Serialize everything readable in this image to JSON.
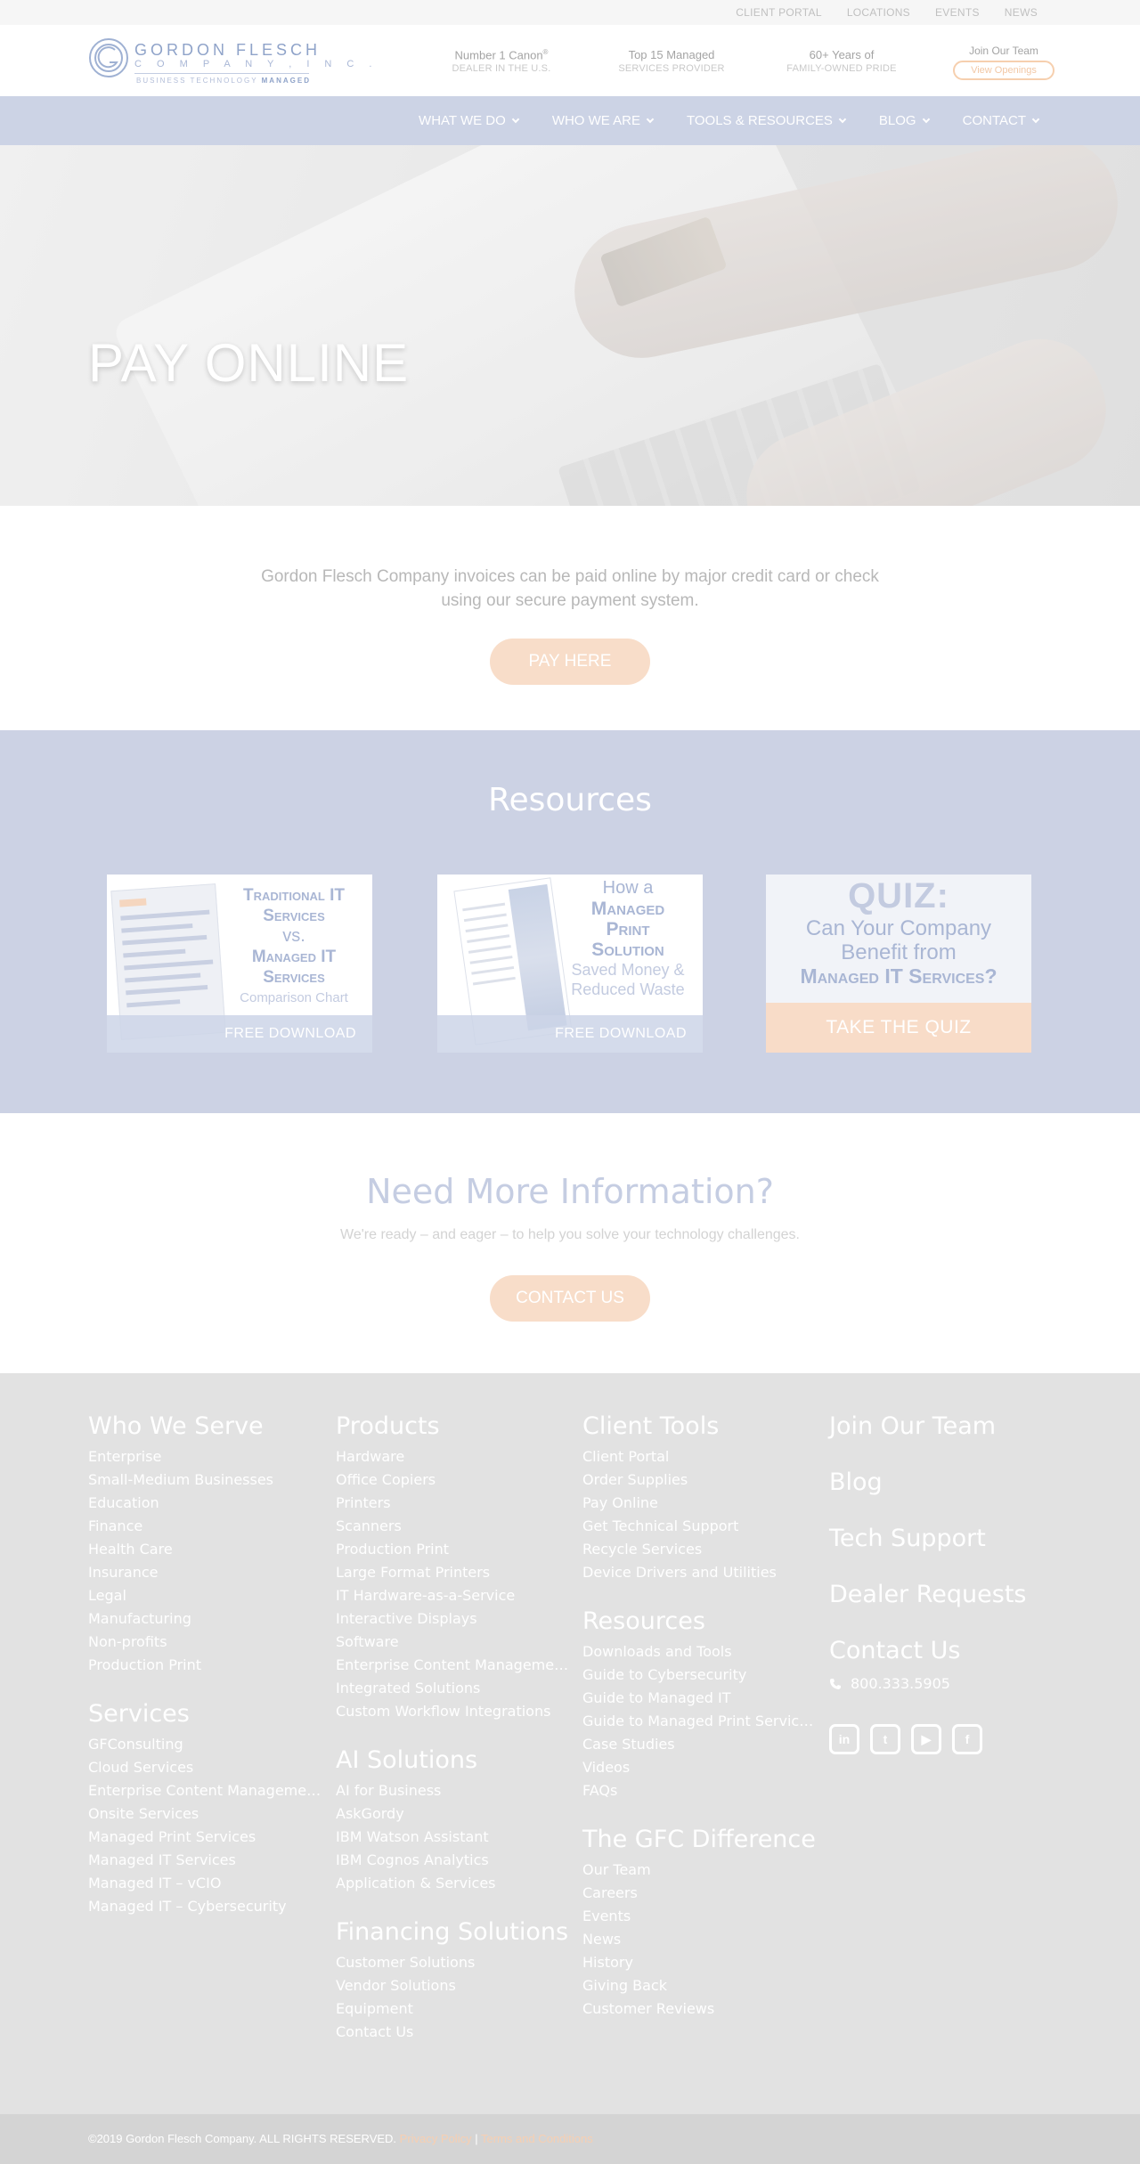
{
  "topbar": {
    "links": [
      "CLIENT PORTAL",
      "LOCATIONS",
      "EVENTS",
      "NEWS"
    ]
  },
  "logo": {
    "name": "GORDON FLESCH",
    "sub": "C O M P A N Y , I N C .",
    "tag_prefix": "BUSINESS TECHNOLOGY",
    "tag_bold": "MANAGED"
  },
  "stats": [
    {
      "line1": "Number 1 Canon",
      "sup": "®",
      "line2": "DEALER IN THE U.S."
    },
    {
      "line1": "Top 15 Managed",
      "line2": "SERVICES PROVIDER"
    },
    {
      "line1": "60+ Years of",
      "line2": "FAMILY-OWNED PRIDE"
    }
  ],
  "join": {
    "label": "Join Our Team",
    "button": "View Openings"
  },
  "nav": [
    "WHAT WE DO",
    "WHO WE ARE",
    "TOOLS & RESOURCES",
    "BLOG",
    "CONTACT"
  ],
  "hero": {
    "title": "PAY ONLINE"
  },
  "intro": {
    "text": "Gordon Flesch Company invoices can be paid online by major credit card or check using our secure payment system.",
    "button": "PAY HERE"
  },
  "resources": {
    "heading": "Resources",
    "card1": {
      "t1": "Traditional IT",
      "t2": "Services",
      "vs": "vs.",
      "t3": "Managed IT",
      "t4": "Services",
      "sub": "Comparison Chart",
      "cta": "FREE DOWNLOAD"
    },
    "card2": {
      "t1": "How a",
      "t2": "Managed",
      "t3": "Print",
      "t4": "Solution",
      "s1": "Saved Money &",
      "s2": "Reduced Waste",
      "cta": "FREE DOWNLOAD"
    },
    "card3": {
      "q1": "QUIZ:",
      "q2": "Can Your Company",
      "q3": "Benefit from",
      "q4": "Managed IT Services?",
      "cta": "TAKE THE QUIZ"
    }
  },
  "more": {
    "heading": "Need More Information?",
    "text": "We're ready – and eager – to help you solve your technology challenges.",
    "button": "CONTACT US"
  },
  "footer": {
    "who_we_serve": {
      "title": "Who We Serve",
      "items": [
        "Enterprise",
        "Small-Medium Businesses",
        "Education",
        "Finance",
        "Health Care",
        "Insurance",
        "Legal",
        "Manufacturing",
        "Non-profits",
        "Production Print"
      ]
    },
    "services": {
      "title": "Services",
      "items": [
        "GFConsulting",
        "Cloud Services",
        "Enterprise Content Manageme…",
        "Onsite Services",
        "Managed Print Services",
        "Managed IT Services",
        "Managed IT – vCIO",
        "Managed IT – Cybersecurity"
      ]
    },
    "products": {
      "title": "Products",
      "items": [
        "Hardware",
        "Office Copiers",
        "Printers",
        "Scanners",
        "Production Print",
        "Large Format Printers",
        "IT Hardware-as-a-Service",
        "Interactive Displays",
        "Software",
        "Enterprise Content Manageme…",
        "Integrated Solutions",
        "Custom Workflow Integrations"
      ]
    },
    "ai": {
      "title": "AI Solutions",
      "items": [
        "AI for Business",
        "AskGordy",
        "IBM Watson Assistant",
        "IBM Cognos Analytics",
        "Application & Services"
      ]
    },
    "financing": {
      "title": "Financing Solutions",
      "items": [
        "Customer Solutions",
        "Vendor Solutions",
        "Equipment",
        "Contact Us"
      ]
    },
    "client_tools": {
      "title": "Client Tools",
      "items": [
        "Client Portal",
        "Order Supplies",
        "Pay Online",
        "Get Technical Support",
        "Recycle Services",
        "Device Drivers and Utilities"
      ]
    },
    "resources": {
      "title": "Resources",
      "items": [
        "Downloads and Tools",
        "Guide to Cybersecurity",
        "Guide to Managed IT",
        "Guide to Managed Print Servic…",
        "Case Studies",
        "Videos",
        "FAQs"
      ]
    },
    "difference": {
      "title": "The GFC Difference",
      "items": [
        "Our Team",
        "Careers",
        "Events",
        "News",
        "History",
        "Giving Back",
        "Customer Reviews"
      ]
    },
    "right": {
      "join": "Join Our Team",
      "blog": "Blog",
      "support": "Tech Support",
      "dealer": "Dealer Requests",
      "contact": "Contact Us",
      "phone": "800.333.5905"
    },
    "socials": [
      "linkedin-icon",
      "twitter-icon",
      "youtube-icon",
      "facebook-icon"
    ]
  },
  "bottom": {
    "copyright": "©2019 Gordon Flesch Company. ALL RIGHTS RESERVED.",
    "privacy": "Privacy Policy",
    "sep": "|",
    "terms": "Terms and Conditions"
  },
  "colors": {
    "nav": "#ccd3e5",
    "accent": "#f8ddc9",
    "footer": "#e2e2e2"
  }
}
